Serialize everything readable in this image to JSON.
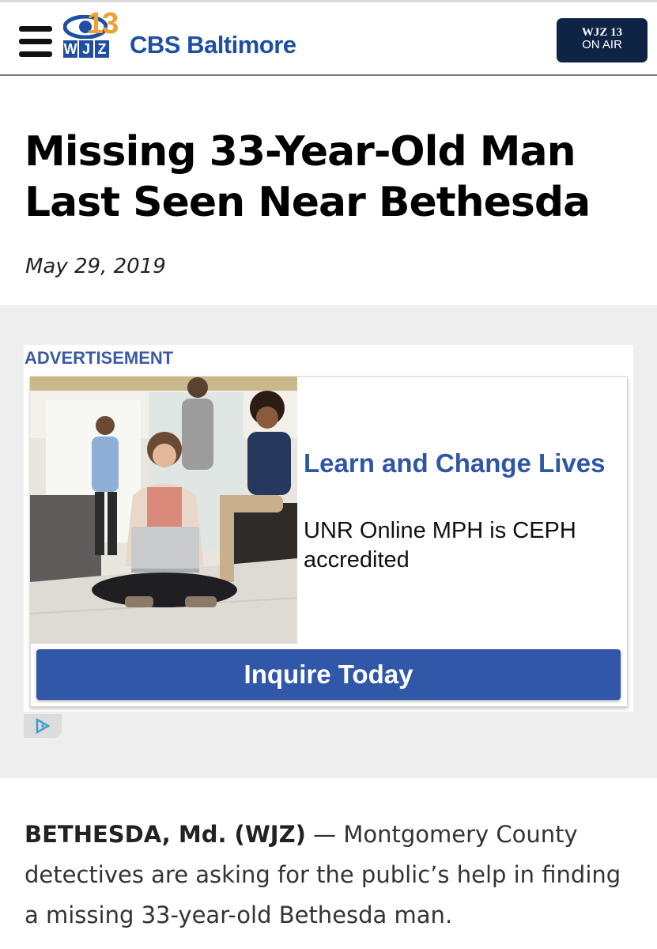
{
  "header": {
    "logo": {
      "channel_number": "13",
      "station_letters": [
        "W",
        "J",
        "Z"
      ],
      "brand_name": "CBS Baltimore"
    },
    "on_air_button": {
      "line1": "WJZ 13",
      "line2": "ON AIR"
    },
    "colors": {
      "brand_blue": "#1e4fa3",
      "on_air_bg": "#0f2347",
      "accent_orange": "#f0a030"
    }
  },
  "article": {
    "title": "Missing 33-Year-Old Man Last Seen Near Bethesda",
    "date": "May 29, 2019",
    "dateline": "BETHESDA, Md. (WJZ)",
    "dash": " — ",
    "lead": "Montgomery County detectives are asking for the public’s help in finding a missing 33-year-old Bethesda man."
  },
  "advertisement": {
    "label": "ADVERTISEMENT",
    "headline": "Learn and Change Lives",
    "body": "UNR Online MPH is CEPH accredited",
    "cta_label": "Inquire Today",
    "colors": {
      "label": "#3a5aa5",
      "headline": "#2f56a6",
      "button": "#3157a8"
    }
  }
}
